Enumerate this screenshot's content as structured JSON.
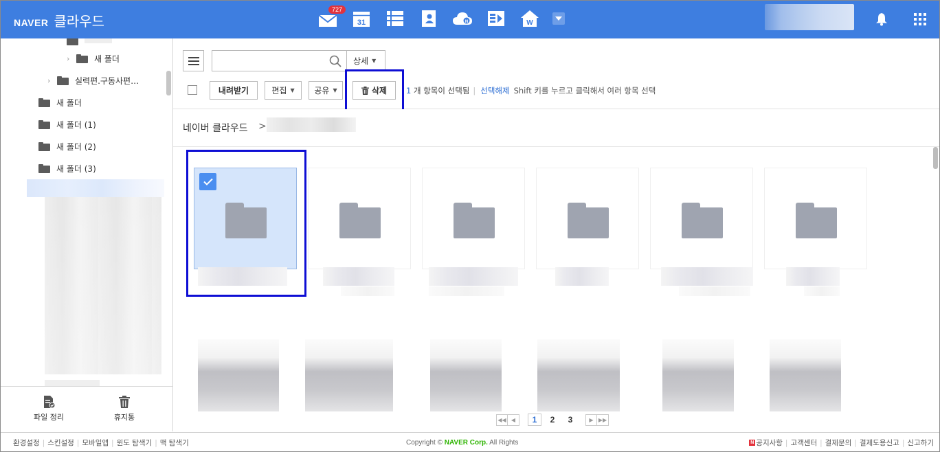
{
  "header": {
    "brand_naver": "NAVER",
    "brand_service": "클라우드",
    "mail_badge": "727",
    "calendar_day": "31",
    "apps": [
      "mail-icon",
      "calendar-icon",
      "memo-list-icon",
      "contacts-icon",
      "cloud-icon",
      "office-icon",
      "blog-home-icon",
      "more-apps-icon"
    ],
    "accent": "#3e7ee0"
  },
  "sidebar": {
    "tree": [
      {
        "label": "새 폴더",
        "expand": true
      },
      {
        "label": "실력편.구동사편…",
        "expand": true
      },
      {
        "label": "새 폴더",
        "expand": false
      },
      {
        "label": "새 폴더 (1)",
        "expand": false
      },
      {
        "label": "새 폴더 (2)",
        "expand": false
      },
      {
        "label": "새 폴더 (3)",
        "expand": false
      }
    ],
    "tools": {
      "file_organize": "파일 정리",
      "trash": "휴지통"
    }
  },
  "toolbar": {
    "search_placeholder": "",
    "detail_label": "상세",
    "download_label": "내려받기",
    "edit_label": "편집",
    "share_label": "공유",
    "delete_label": "삭제",
    "selected_count": "1",
    "selected_text": " 개 항목이 선택됨",
    "deselect_label": "선택해제",
    "shift_hint": "Shift 키를 누르고 클릭해서 여러 항목 선택"
  },
  "breadcrumb": {
    "root": "네이버 클라우드",
    "separator": ">"
  },
  "grid": {
    "selected_index": 0,
    "check_color": "#4a8ef0",
    "highlight_color": "#0e0ed4"
  },
  "pagination": {
    "pages": [
      "1",
      "2",
      "3"
    ],
    "current": "1"
  },
  "footer": {
    "left_links": [
      "환경설정",
      "스킨설정",
      "모바일앱",
      "윈도 탐색기",
      "맥 탐색기"
    ],
    "copyright_prefix": "Copyright ©",
    "copyright_corp": "NAVER Corp.",
    "copyright_suffix": "All Rights",
    "notice_badge": "N",
    "right_links": [
      "공지사항",
      "고객센터",
      "결제문의",
      "결제도용신고",
      "신고하기"
    ]
  }
}
